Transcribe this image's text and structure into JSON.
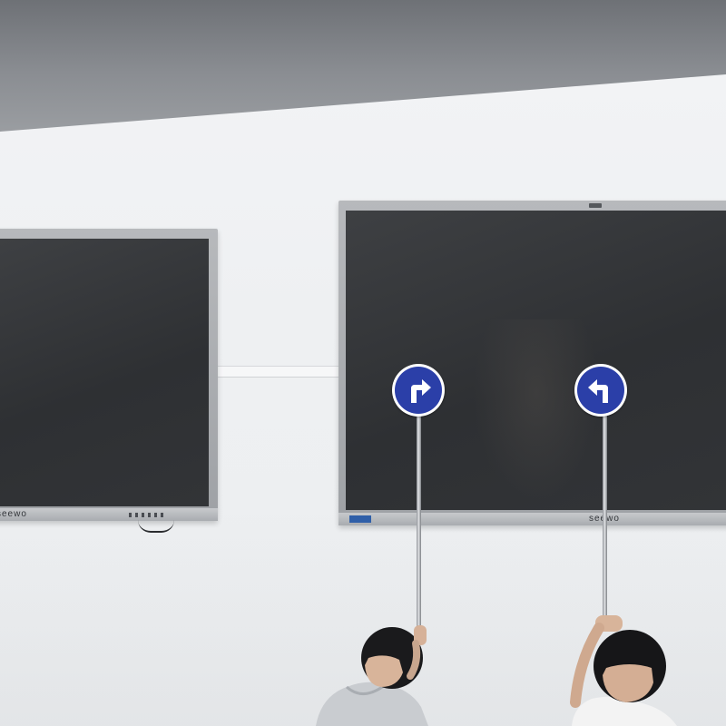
{
  "scene": {
    "description_label": "",
    "left_board": {
      "brand": "seewo"
    },
    "right_board": {
      "brand": "seewo"
    },
    "signs": [
      {
        "name": "turn-right-sign",
        "arrow": "right"
      },
      {
        "name": "turn-left-sign",
        "arrow": "left"
      }
    ],
    "colors": {
      "sign_blue": "#2b3fa8",
      "screen": "#323437",
      "frame": "#a9acb0",
      "wall": "#eef0f2",
      "ceiling": "#7a7d82"
    }
  }
}
